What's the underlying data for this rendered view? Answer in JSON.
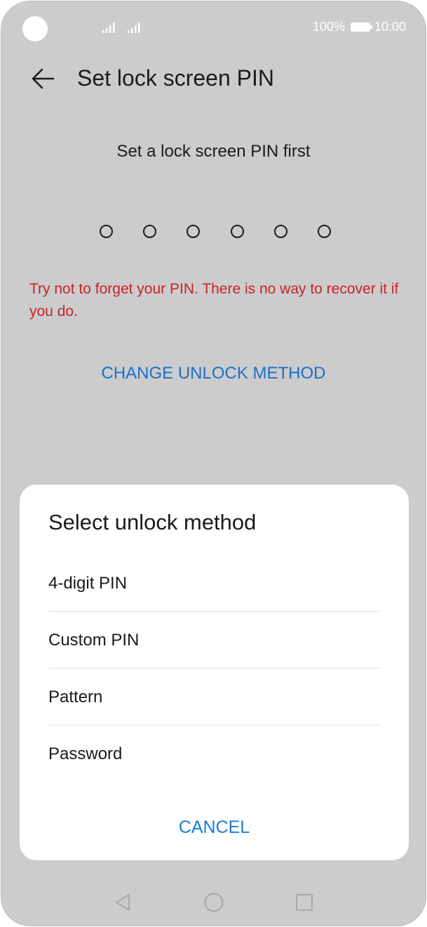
{
  "status_bar": {
    "battery_percent": "100%",
    "time": "10:00",
    "icons": [
      "camera-cutout",
      "signal-icon",
      "signal-icon",
      "battery-icon"
    ]
  },
  "header": {
    "title": "Set lock screen PIN",
    "back_icon": "arrow-left-icon"
  },
  "main": {
    "prompt": "Set a lock screen PIN first",
    "pin_length": 6,
    "warning": "Try not to forget your PIN. There is no way to recover it if you do.",
    "change_method_label": "CHANGE UNLOCK METHOD"
  },
  "dialog": {
    "title": "Select unlock method",
    "options": [
      {
        "label": "4-digit PIN"
      },
      {
        "label": "Custom PIN"
      },
      {
        "label": "Pattern"
      },
      {
        "label": "Password"
      }
    ],
    "cancel_label": "CANCEL"
  },
  "nav_bar": {
    "icons": [
      "back-triangle-icon",
      "home-circle-icon",
      "recents-square-icon"
    ]
  },
  "colors": {
    "scrim_background": "#cccccc",
    "warning_text": "#c8222a",
    "link_blue": "#1a6fc9",
    "dialog_background": "#ffffff"
  }
}
